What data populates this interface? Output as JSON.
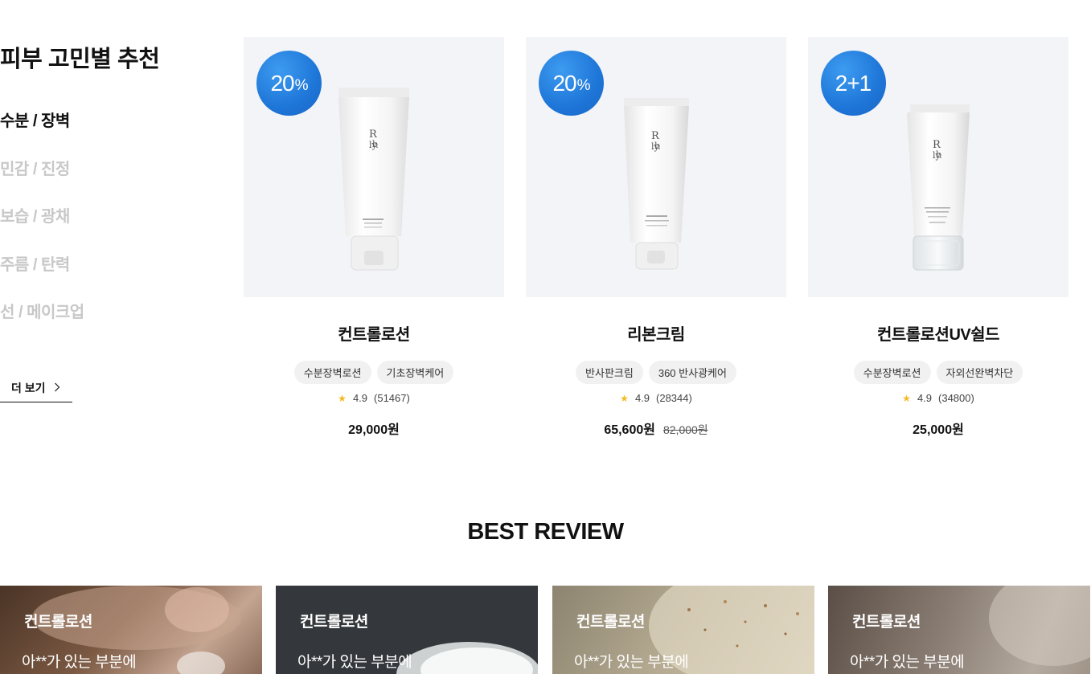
{
  "recommend": {
    "title": "피부 고민별 추천",
    "concerns": [
      "수분 / 장벽",
      "민감 / 진정",
      "보습 / 광채",
      "주름 / 탄력",
      "선 / 메이크업"
    ],
    "more_label": "더 보기",
    "more_icon": "chevron-right-icon"
  },
  "products": [
    {
      "badge_main": "20",
      "badge_suffix": "%",
      "name": "컨트롤로션",
      "tags": [
        "수분장벽로션",
        "기초장벽케어"
      ],
      "rating": "4.9",
      "reviews": "(51467)",
      "price": "29,000원",
      "original_price": ""
    },
    {
      "badge_main": "20",
      "badge_suffix": "%",
      "name": "리본크림",
      "tags": [
        "반사판크림",
        "360 반사광케어"
      ],
      "rating": "4.9",
      "reviews": "(28344)",
      "price": "65,600원",
      "original_price": "82,000원"
    },
    {
      "badge_main": "2+1",
      "badge_suffix": "",
      "name": "컨트롤로션UV쉴드",
      "tags": [
        "수분장벽로션",
        "자외선완벽차단"
      ],
      "rating": "4.9",
      "reviews": "(34800)",
      "price": "25,000원",
      "original_price": ""
    }
  ],
  "best_review": {
    "title": "BEST REVIEW",
    "cards": [
      {
        "product": "컨트롤로션",
        "text": "아**가 있는 부분에"
      },
      {
        "product": "컨트롤로션",
        "text": "아**가 있는 부분에"
      },
      {
        "product": "컨트롤로션",
        "text": "아**가 있는 부분에"
      },
      {
        "product": "컨트롤로션",
        "text": "아**가 있는 부분에"
      }
    ]
  },
  "colors": {
    "badge": "#1e76d8",
    "star": "#f6b922",
    "thumb_bg": "#f3f4f7",
    "inactive_menu": "#c8c8c8"
  }
}
